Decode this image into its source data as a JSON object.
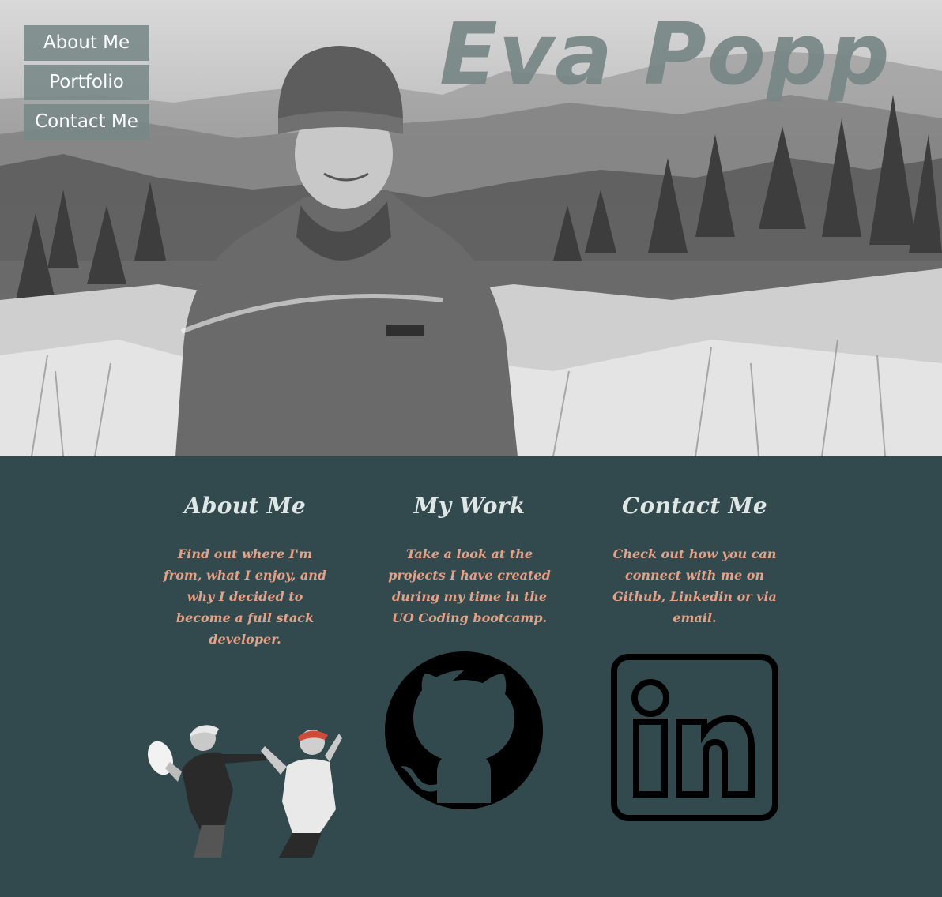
{
  "nav": {
    "items": [
      {
        "label": "About Me"
      },
      {
        "label": "Portfolio"
      },
      {
        "label": "Contact Me"
      }
    ]
  },
  "hero": {
    "name": "Eva Popp"
  },
  "sections": {
    "about": {
      "title": "About Me",
      "text": "Find out where I'm from, what I enjoy, and why I decided to become a full stack developer."
    },
    "work": {
      "title": "My Work",
      "text": "Take a look at the projects I have created during my time in the UO Coding bootcamp."
    },
    "contact": {
      "title": "Contact Me",
      "text": "Check out how you can connect with me on Github, Linkedin or via email."
    }
  },
  "icons": {
    "github": "github-icon",
    "linkedin": "linkedin-icon"
  },
  "colors": {
    "background": "#324a4d",
    "heading": "#dfe6e6",
    "body_text": "#e3a188",
    "nav_button": "#788888",
    "name_text": "#768686"
  }
}
